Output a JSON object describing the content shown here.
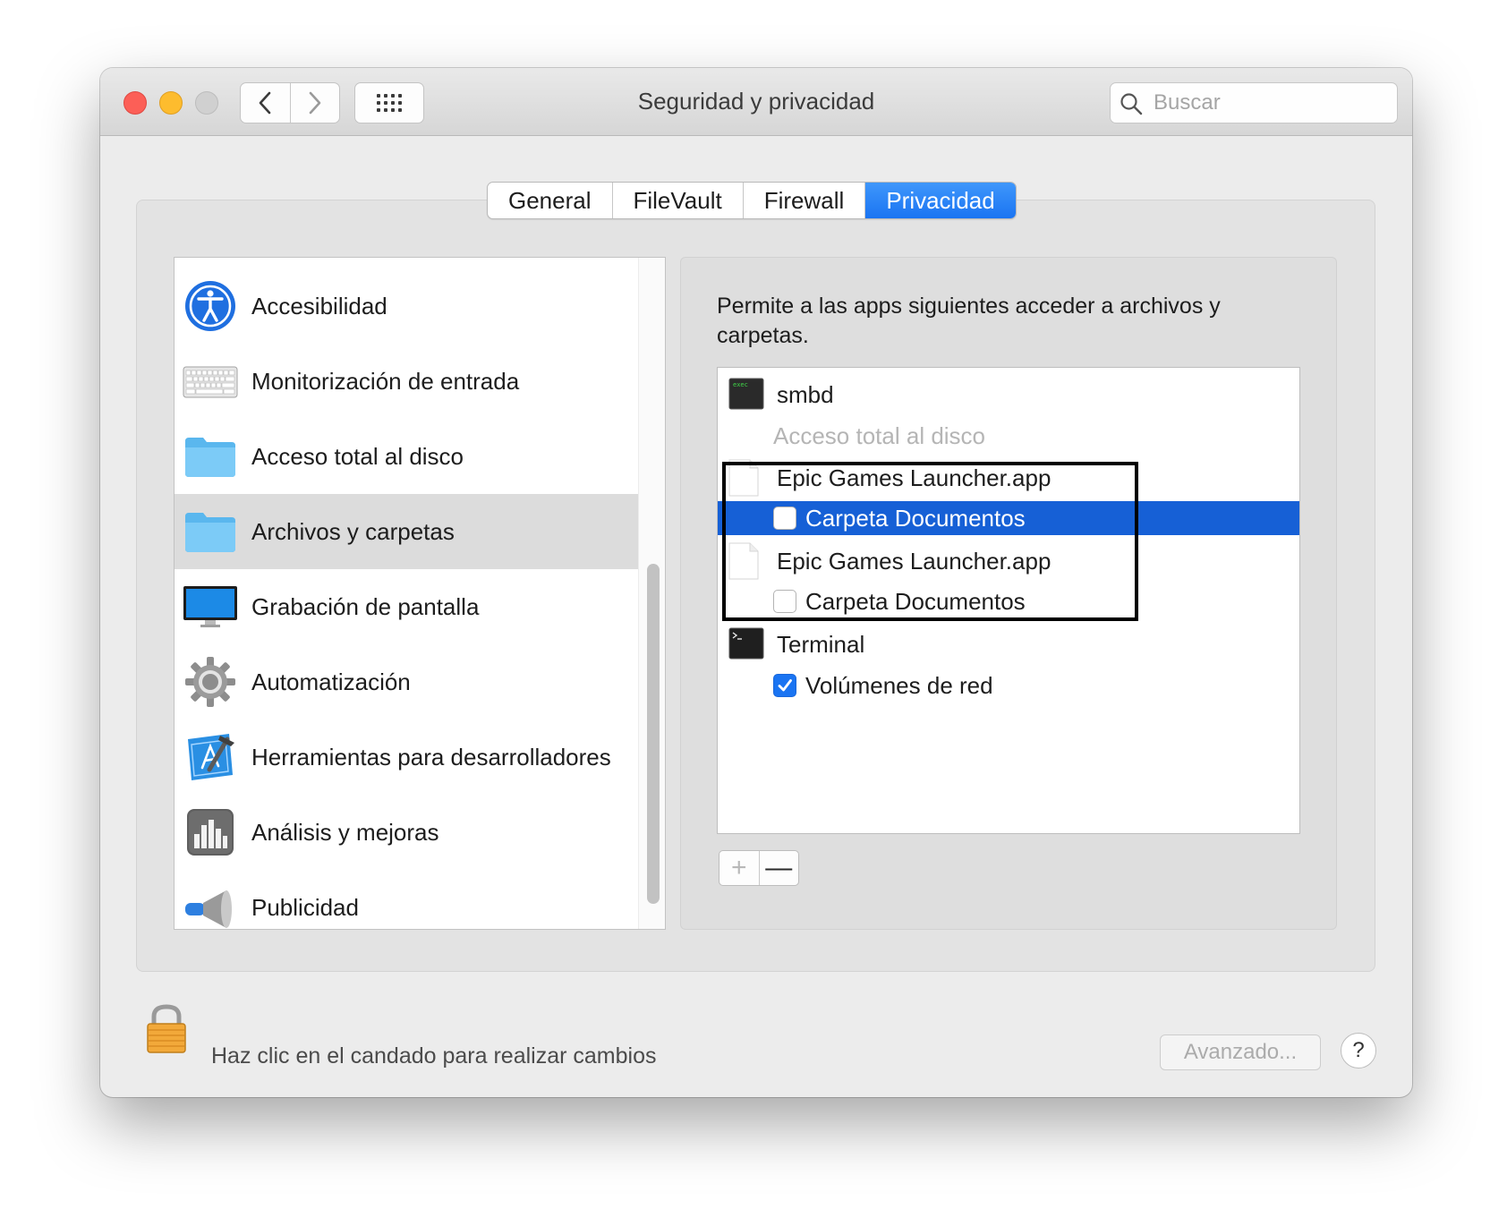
{
  "window": {
    "title": "Seguridad y privacidad",
    "search_placeholder": "Buscar"
  },
  "tabs": [
    {
      "label": "General",
      "active": false
    },
    {
      "label": "FileVault",
      "active": false
    },
    {
      "label": "Firewall",
      "active": false
    },
    {
      "label": "Privacidad",
      "active": true
    }
  ],
  "sidebar": {
    "items": [
      {
        "label": "",
        "icon": "partial-icon"
      },
      {
        "label": "Accesibilidad",
        "icon": "accessibility-icon"
      },
      {
        "label": "Monitorización de entrada",
        "icon": "keyboard-icon"
      },
      {
        "label": "Acceso total al disco",
        "icon": "folder-icon"
      },
      {
        "label": "Archivos y carpetas",
        "icon": "folder-icon",
        "selected": true
      },
      {
        "label": "Grabación de pantalla",
        "icon": "display-icon"
      },
      {
        "label": "Automatización",
        "icon": "gear-icon"
      },
      {
        "label": "Herramientas para desarrolladores",
        "icon": "xcode-icon"
      },
      {
        "label": "Análisis y mejoras",
        "icon": "bar-chart-icon"
      },
      {
        "label": "Publicidad",
        "icon": "megaphone-icon"
      }
    ]
  },
  "panel": {
    "description": "Permite a las apps siguientes acceder a archivos y carpetas.",
    "apps": [
      {
        "name": "smbd",
        "icon": "exec-icon",
        "exec_text": "exec",
        "permissions": [
          {
            "label": "Acceso total al disco",
            "checkbox": false,
            "disabled": true
          }
        ]
      },
      {
        "name": "Epic Games Launcher.app",
        "icon": "document-icon",
        "permissions": [
          {
            "label": "Carpeta Documentos",
            "checked": false,
            "selected": true
          }
        ]
      },
      {
        "name": "Epic Games Launcher.app",
        "icon": "document-icon",
        "permissions": [
          {
            "label": "Carpeta Documentos",
            "checked": false
          }
        ]
      },
      {
        "name": "Terminal",
        "icon": "terminal-icon",
        "permissions": [
          {
            "label": "Volúmenes de red",
            "checked": true
          }
        ]
      }
    ],
    "add_label": "+",
    "remove_label": "—"
  },
  "footer": {
    "lock_text": "Haz clic en el candado para realizar cambios",
    "advanced_label": "Avanzado...",
    "help_label": "?"
  },
  "colors": {
    "accent": "#1a74f2",
    "selection": "#1660d6",
    "close": "#fc5f57",
    "minimize": "#fdbc2e",
    "zoom_disabled": "#d0d0d0"
  }
}
